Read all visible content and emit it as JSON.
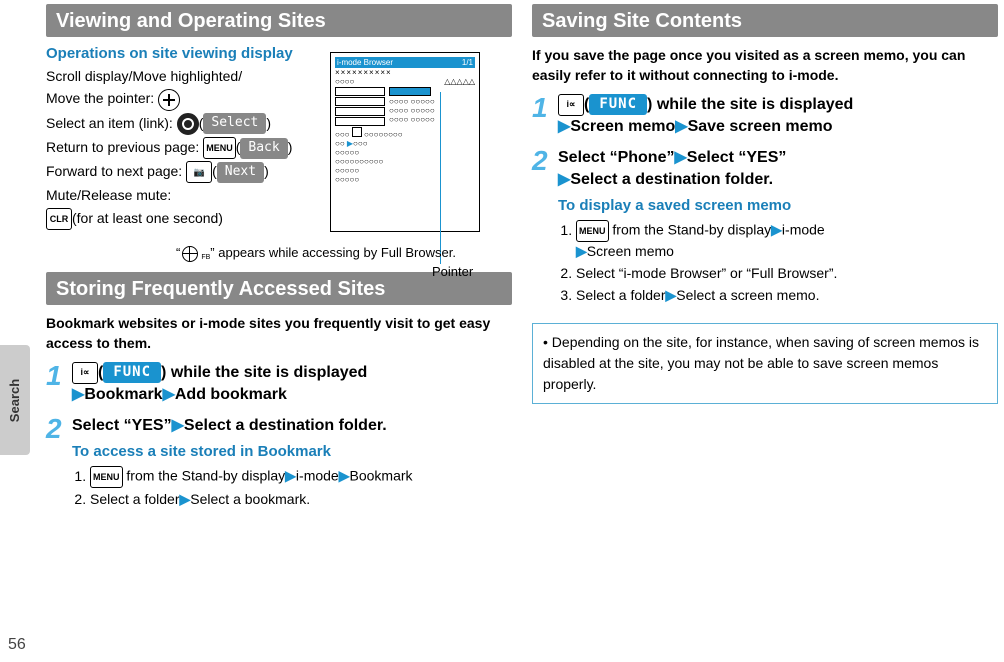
{
  "sidebar": {
    "tab": "Search",
    "page": "56"
  },
  "left": {
    "h1": "Viewing and Operating Sites",
    "ops_title": "Operations on site viewing display",
    "scroll": "Scroll display/Move highlighted/",
    "move_pointer": "Move the pointer:",
    "select_item": "Select an item (link):",
    "select_pill": "Select",
    "return": "Return to previous page:",
    "back_pill": "Back",
    "forward": "Forward to next page:",
    "next_pill": "Next",
    "mute": "Mute/Release mute:",
    "mute2": "(for at least one second)",
    "clr": "CLR",
    "menu": "MENU",
    "fb_note_pre": "“",
    "fb_note_post": "” appears while accessing by Full Browser.",
    "fb_sub": "FB",
    "pointer_label": "Pointer",
    "phone_title_left": "i-mode Browser",
    "phone_title_right": "1/1",
    "h2": "Storing Frequently Accessed Sites",
    "intro2": "Bookmark websites or i-mode sites you frequently visit to get easy access to them.",
    "step1_num": "1",
    "func": "FUNC",
    "step1_a": ") while the site is displayed",
    "step1_b": "Bookmark",
    "step1_c": "Add bookmark",
    "step2_num": "2",
    "step2_a": "Select “YES”",
    "step2_b": "Select a destination folder.",
    "sub2": "To access a site stored in Bookmark",
    "ol2_1a": " from the Stand-by display",
    "ol2_1b": "i-mode",
    "ol2_1c": "Bookmark",
    "ol2_2a": "Select a folder",
    "ol2_2b": "Select a bookmark."
  },
  "right": {
    "h1": "Saving Site Contents",
    "intro": "If you save the page once you visited as a screen memo, you can easily refer to it without connecting to i-mode.",
    "step1_num": "1",
    "step1_a": ") while the site is displayed",
    "step1_b": "Screen memo",
    "step1_c": "Save screen memo",
    "step2_num": "2",
    "step2_a": "Select “Phone”",
    "step2_b": "Select “YES”",
    "step2_c": "Select a destination folder.",
    "sub": "To display a saved screen memo",
    "ol_1a": " from the Stand-by display",
    "ol_1b": "i-mode",
    "ol_1c": "Screen memo",
    "ol_2": "Select “i-mode Browser” or “Full Browser”.",
    "ol_3a": "Select a folder",
    "ol_3b": "Select a screen memo.",
    "note": "Depending on the site, for instance, when saving of screen memos is disabled at the site, you may not be able to save screen memos properly."
  }
}
